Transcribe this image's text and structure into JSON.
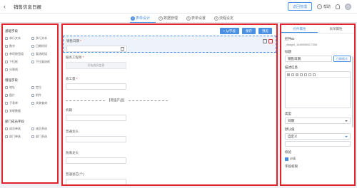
{
  "header": {
    "back_icon": "arrow-left-icon",
    "title": "销售信息日报",
    "right": {
      "manage_label": "返回管理",
      "help_label": "帮助"
    }
  },
  "steps": [
    {
      "num": "1",
      "label": "表单设计"
    },
    {
      "num": "2",
      "label": "数据管理"
    },
    {
      "num": "3",
      "label": "表单设置"
    },
    {
      "num": "4",
      "label": "流程设定"
    }
  ],
  "left_panel": {
    "sections": [
      {
        "title": "基础字段",
        "items": [
          "单行文本",
          "多行文本",
          "数字",
          "日期时间",
          "单项按钮组",
          "复选框组",
          "下拉框",
          "下拉复选框",
          "分割线"
        ]
      },
      {
        "title": "增强字段",
        "items": [
          "地址",
          "定位",
          "图片",
          "附件",
          "子表单",
          "关联查询",
          "关联数据"
        ]
      },
      {
        "title": "部门成员字段",
        "items": [
          "成员单选",
          "成员多选",
          "部门单选",
          "部门多选"
        ]
      }
    ]
  },
  "canvas": {
    "toolbar": {
      "component_label": "+ 从字段",
      "save_label": "保存",
      "preview_label": "预览"
    },
    "fields": {
      "sales_date": {
        "label": "销售日期",
        "required": "*"
      },
      "engineer": {
        "label": "服务工程师",
        "required": "*",
        "button": "添加成员信息"
      },
      "cashier": {
        "label": "收工量",
        "required": "*"
      },
      "divider": "【增强产品】",
      "f1": {
        "label": "机箱"
      },
      "f2": {
        "label": "普通龙头"
      },
      "f3": {
        "label": "防溅龙头"
      },
      "f4": {
        "label": "普通滤芯(个)"
      }
    }
  },
  "right_panel": {
    "tabs": [
      "控件属性",
      "表单属性"
    ],
    "control_id_label": "控件ID",
    "control_id_value": "_widget_1465058017358",
    "title_label": "标题",
    "title_value": "销售日期",
    "title_button": "日期格式",
    "desc_label": "描述信息",
    "type_label": "类型",
    "type_value": "日期",
    "default_label": "默认值",
    "default_value": "自定义",
    "check_label": "校验",
    "check_option": "必填",
    "field_perm_label": "字段权限"
  }
}
